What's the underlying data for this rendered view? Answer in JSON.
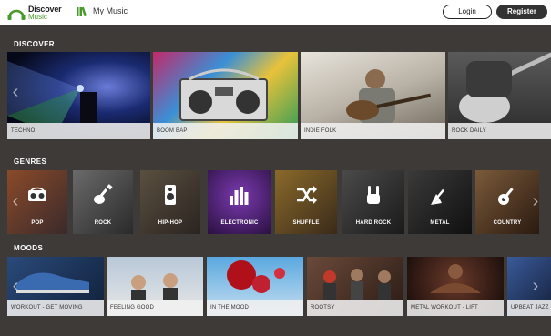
{
  "header": {
    "logo_line1": "Discover",
    "logo_line2": "Music",
    "nav_label": "My Music",
    "login_label": "Login",
    "register_label": "Register"
  },
  "discover": {
    "title": "DISCOVER",
    "items": [
      {
        "label": "TECHNO"
      },
      {
        "label": "BOOM BAP"
      },
      {
        "label": "INDIE FOLK"
      },
      {
        "label": "ROCK DAILY"
      }
    ]
  },
  "genres": {
    "title": "GENRES",
    "items": [
      {
        "label": "POP",
        "icon": "boombox-icon"
      },
      {
        "label": "ROCK",
        "icon": "guitar-icon"
      },
      {
        "label": "HIP-HOP",
        "icon": "speaker-icon"
      },
      {
        "label": "ELECTRONIC",
        "icon": "equalizer-icon"
      },
      {
        "label": "SHUFFLE",
        "icon": "shuffle-icon"
      },
      {
        "label": "HARD ROCK",
        "icon": "rock-hand-icon"
      },
      {
        "label": "METAL",
        "icon": "flying-v-guitar-icon"
      },
      {
        "label": "COUNTRY",
        "icon": "acoustic-guitar-icon"
      }
    ]
  },
  "moods": {
    "title": "MOODS",
    "items": [
      {
        "label": "WORKOUT - GET MOVING"
      },
      {
        "label": "FEELING GOOD"
      },
      {
        "label": "IN THE MOOD"
      },
      {
        "label": "ROOTSY"
      },
      {
        "label": "METAL WORKOUT - LIFT"
      },
      {
        "label": "UPBEAT JAZZ"
      }
    ]
  },
  "colors": {
    "background": "#3d3a37",
    "brand_green": "#4a9a2a",
    "caption_bg": "#f0f0f0"
  }
}
